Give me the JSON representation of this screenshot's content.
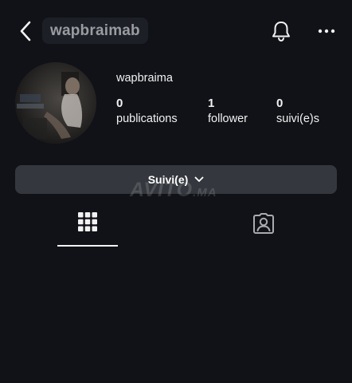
{
  "header": {
    "username": "wapbraimab",
    "icons": {
      "back": "chevron-left-icon",
      "notifications": "bell-icon",
      "more": "more-horizontal-icon"
    }
  },
  "profile": {
    "display_name": "wapbraima",
    "stats": [
      {
        "value": "0",
        "label": "publications"
      },
      {
        "value": "1",
        "label": "follower"
      },
      {
        "value": "0",
        "label": "suivi(e)s"
      }
    ]
  },
  "actions": {
    "follow_label": "Suivi(e)"
  },
  "watermark": {
    "brand": "AVITO",
    "suffix": ".MA"
  },
  "tabs": [
    {
      "name": "posts-grid",
      "icon": "grid-icon",
      "selected": true
    },
    {
      "name": "tagged",
      "icon": "tagged-user-icon",
      "selected": false
    }
  ],
  "colors": {
    "background": "#101217",
    "button": "#34373d",
    "text": "#f2f2f2"
  }
}
